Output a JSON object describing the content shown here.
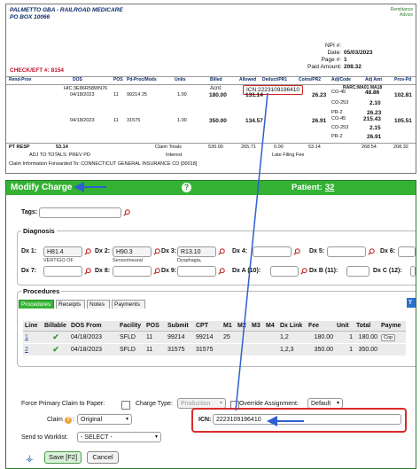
{
  "remittance": {
    "payer_name": "PALMETTO GBA - RAILROAD MEDICARE",
    "payer_address": "PO BOX 10066",
    "advice_label_1": "Remittance",
    "advice_label_2": "Advice",
    "npi_label": "NPI #:",
    "npi_value": "",
    "date_label": "Date:",
    "date_value": "05/03/2023",
    "page_label": "Page #:",
    "page_value": "1",
    "paid_label": "Paid Amount:",
    "paid_value": "208.32",
    "check_label": "CHECK/EFT #: 8154",
    "columns": [
      "Rend-Prov",
      "DOS",
      "POS",
      "Pd-Proc/Mods",
      "Units",
      "Billed",
      "Allowed",
      "Deduct/PR1",
      "Coins/PR2",
      "Adj/Code",
      "Adj Amt",
      "Prov-Pd"
    ],
    "acnt_label": "Acnt:",
    "icn_text": "ICN:2223109196410",
    "rarc_text": "RARC:MA01 MA18",
    "hic_text": "HIC:3E86R58WN76",
    "lines": [
      {
        "dos": "04/18/2023",
        "pos": "11",
        "proc": "99214 25",
        "units": "1.00",
        "billed": "180.00",
        "allowed": "131.14",
        "coins": "26.23",
        "adjs": [
          {
            "code": "CO-45",
            "amt": "48.86"
          },
          {
            "code": "CO-253",
            "amt": "2.10"
          },
          {
            "code": "PR-2",
            "amt": "26.23"
          }
        ],
        "prov_pd": "102.81"
      },
      {
        "dos": "04/18/2023",
        "pos": "11",
        "proc": "31575",
        "units": "1.00",
        "billed": "350.00",
        "allowed": "134.57",
        "coins": "26.91",
        "adjs": [
          {
            "code": "CO-45",
            "amt": "215.43"
          },
          {
            "code": "CO-253",
            "amt": "2.15"
          },
          {
            "code": "PR-2",
            "amt": "26.91"
          }
        ],
        "prov_pd": "105.51"
      }
    ],
    "pt_resp_label": "PT RESP",
    "pt_resp_value": "53.14",
    "adj_totals_label": "ADJ TO TOTALS: PREV PD",
    "claim_totals_label": "Claim Totals",
    "claim_totals": {
      "billed": "530.00",
      "allowed": "265.71",
      "deduct": "0.00",
      "coins": "53.14",
      "adj": "268.54",
      "prov_pd": "208.32"
    },
    "interest_label": "Interest",
    "late_filing_label": "Late Filing Fee",
    "claim_info": "Claim Information Forwarded To: CONNECTICUT GENERAL INSURANCE CO [00018]"
  },
  "modify_charge": {
    "title": "Modify Charge",
    "help_glyph": "?",
    "patient_label": "Patient:",
    "patient_value": "32",
    "tags_label": "Tags:",
    "tags_value": "",
    "diagnosis_title": "Diagnosis",
    "dx": [
      {
        "label": "Dx 1:",
        "code": "H81.4",
        "desc": "VERTIGO OF"
      },
      {
        "label": "Dx 2:",
        "code": "H90.3",
        "desc": "Sensorineural"
      },
      {
        "label": "Dx 3:",
        "code": "R13.10",
        "desc": "Dysphagia,"
      },
      {
        "label": "Dx 4:",
        "code": "",
        "desc": ""
      },
      {
        "label": "Dx 5:",
        "code": "",
        "desc": ""
      },
      {
        "label": "Dx 6:",
        "code": "",
        "desc": ""
      },
      {
        "label": "Dx 7:",
        "code": "",
        "desc": ""
      },
      {
        "label": "Dx 8:",
        "code": "",
        "desc": ""
      },
      {
        "label": "Dx 9:",
        "code": "",
        "desc": ""
      },
      {
        "label": "Dx A (10):",
        "code": "",
        "desc": ""
      },
      {
        "label": "Dx B (11):",
        "code": "",
        "desc": ""
      },
      {
        "label": "Dx C (12):",
        "code": "",
        "desc": ""
      }
    ],
    "procedures_title": "Procedures",
    "tabs": [
      "Procedures",
      "Receipts",
      "Notes",
      "Payments"
    ],
    "blue_tab": "T",
    "proc_columns": [
      "Line",
      "Billable",
      "DOS From",
      "Facility",
      "POS",
      "Submit",
      "CPT",
      "M1",
      "M2",
      "M3",
      "M4",
      "Dx Link",
      "Fee",
      "Unit",
      "Total",
      "Payme"
    ],
    "proc_rows": [
      {
        "line": "1",
        "dos": "04/18/2023",
        "facility": "SFLD",
        "pos": "11",
        "submit": "99214",
        "cpt": "99214",
        "m1": "25",
        "m2": "",
        "m3": "",
        "m4": "",
        "dx_link": "1,2",
        "fee": "180.00",
        "unit": "1",
        "total": "180.00",
        "payment": "Cop"
      },
      {
        "line": "2",
        "dos": "04/18/2023",
        "facility": "SFLD",
        "pos": "11",
        "submit": "31575",
        "cpt": "31575",
        "m1": "",
        "m2": "",
        "m3": "",
        "m4": "",
        "dx_link": "1,2,3",
        "fee": "350.00",
        "unit": "1",
        "total": "350.00",
        "payment": ""
      }
    ],
    "force_primary_label": "Force Primary Claim to Paper:",
    "charge_type_label": "Charge Type:",
    "charge_type_value": "Production",
    "override_label": "Override Assignment:",
    "override_value": "Default",
    "claim_label": "Claim",
    "claim_value": "Original",
    "icn_label": "ICN:",
    "icn_value": "2223109196410",
    "send_label": "Send to Worklist:",
    "send_value": "- SELECT -",
    "save_label": "Save [F2]",
    "cancel_label": "Cancel"
  },
  "colors": {
    "accent_green": "#33b233",
    "highlight_red": "#d92b2b",
    "arrow_blue": "#2f5fd0"
  }
}
